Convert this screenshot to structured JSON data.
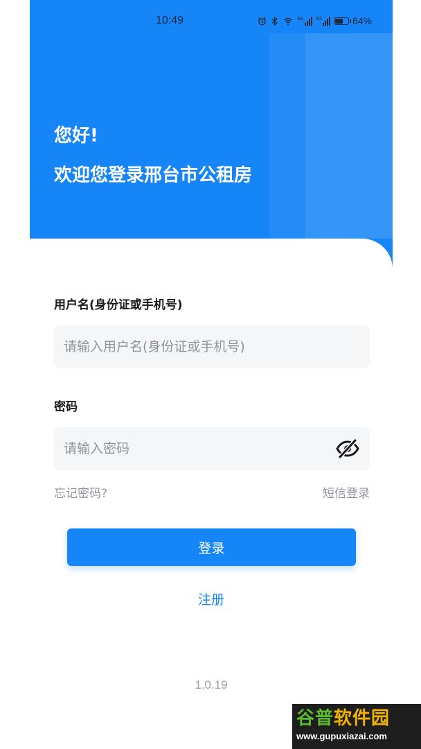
{
  "status_bar": {
    "time": "10:49",
    "battery_percent": "64%",
    "battery_level": 0.64,
    "icons": [
      "alarm-icon",
      "bluetooth-icon",
      "wifi-icon",
      "signal-5g-icon",
      "signal-4g-icon",
      "battery-icon"
    ],
    "network_5g": "5G",
    "network_4g": "4G"
  },
  "header": {
    "greeting": "您好!",
    "welcome": "欢迎您登录邢台市公租房"
  },
  "form": {
    "username_label": "用户名(身份证或手机号)",
    "username_placeholder": "请输入用户名(身份证或手机号)",
    "username_value": "",
    "password_label": "密码",
    "password_placeholder": "请输入密码",
    "password_value": "",
    "password_toggle_icon": "eye-off-icon"
  },
  "links": {
    "forgot_password": "忘记密码?",
    "sms_login": "短信登录"
  },
  "actions": {
    "login_label": "登录",
    "register_label": "注册"
  },
  "footer": {
    "version": "1.0.19"
  },
  "colors": {
    "primary": "#1685f7",
    "input_bg": "#f5f6f8",
    "placeholder": "#8f949b"
  },
  "watermark": {
    "title_part1": "谷普",
    "title_part2": "软件园",
    "url": "www.gupuxiazai.com"
  }
}
